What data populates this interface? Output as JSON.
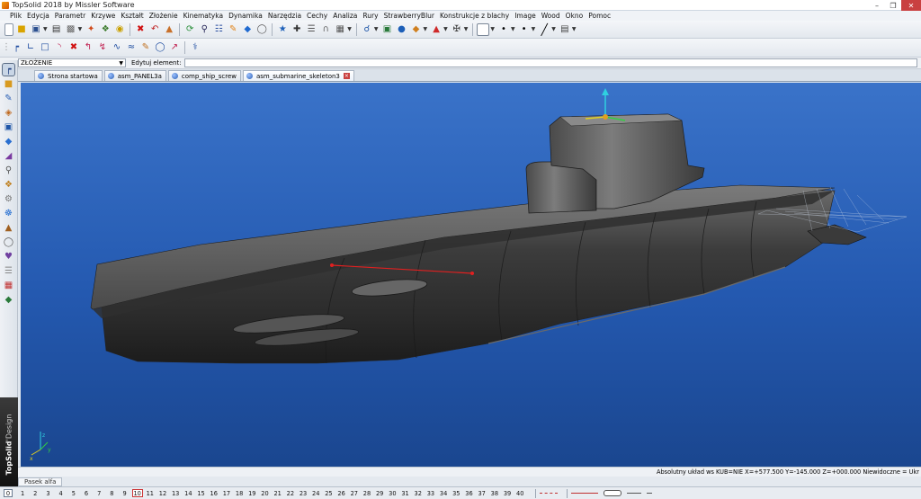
{
  "window": {
    "title": "TopSolid 2018 by Missler Software",
    "controls": [
      "minimize-icon",
      "restore-icon",
      "close-icon"
    ]
  },
  "menu": [
    "Plik",
    "Edycja",
    "Parametr",
    "Krzywe",
    "Kształt",
    "Złożenie",
    "Kinematyka",
    "Dynamika",
    "Narzędzia",
    "Cechy",
    "Analiza",
    "Rury",
    "StrawberryBlur",
    "Konstrukcje z blachy",
    "Image",
    "Wood",
    "Okno",
    "Pomoc"
  ],
  "context": {
    "mode_value": "ZŁOŻENIE",
    "edit_label": "Edytuj element:",
    "edit_value": ""
  },
  "tabs": [
    {
      "label": "Strona startowa",
      "active": false,
      "closable": false
    },
    {
      "label": "asm_PANEL3a",
      "active": false,
      "closable": false
    },
    {
      "label": "comp_ship_screw",
      "active": false,
      "closable": false
    },
    {
      "label": "asm_submarine_skeleton3",
      "active": true,
      "closable": true
    }
  ],
  "viewport": {
    "background_top": "#3a73c9",
    "background_bottom": "#1a468f",
    "model": "submarine hull",
    "triad": {
      "x": "x",
      "y": "y",
      "z": "z"
    }
  },
  "brand": {
    "name": "TopSolid",
    "suffix": "'Design"
  },
  "status": {
    "text": "Absolutny układ ws  KUB=NIE  X=+577.500  Y=-145.000  Z=+000.000  Niewidoczne = Ukr"
  },
  "alpha_tab": "Pasek alfa",
  "layers": {
    "zero": "0",
    "items": [
      "1",
      "2",
      "3",
      "4",
      "5",
      "6",
      "7",
      "8",
      "9",
      "10",
      "11",
      "12",
      "13",
      "14",
      "15",
      "16",
      "17",
      "18",
      "19",
      "20",
      "21",
      "22",
      "23",
      "24",
      "25",
      "26",
      "27",
      "28",
      "29",
      "30",
      "31",
      "32",
      "33",
      "34",
      "35",
      "36",
      "37",
      "38",
      "39",
      "40"
    ],
    "current": "10"
  },
  "colors": {
    "accent_red": "#e02020",
    "titlebar_close": "#c94040",
    "hull": "#3b3b3b"
  }
}
